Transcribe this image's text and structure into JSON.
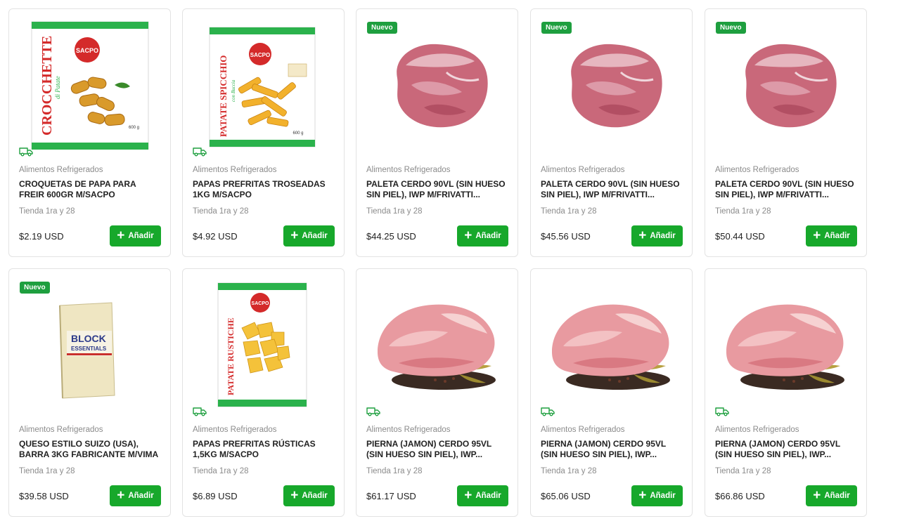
{
  "colors": {
    "accent": "#17a82b",
    "badge": "#1e9f3f",
    "muted": "#8b8b8b"
  },
  "products": [
    {
      "badge": "",
      "image": "croquettes-bag",
      "delivery": true,
      "brand_text": "SACPO",
      "package_name": "CROCCHETTE",
      "package_sub": "di Patate",
      "package_weight": "600 g",
      "category": "Alimentos Refrigerados",
      "title": "CROQUETAS DE PAPA PARA FREIR 600GR M/SACPO",
      "store": "Tienda 1ra y 28",
      "price": "$2.19 USD",
      "button": "Añadir"
    },
    {
      "badge": "",
      "image": "fries-bag",
      "delivery": true,
      "brand_text": "SACPO",
      "package_name": "PATATE SPICCHIO",
      "package_sub": "con Buccia",
      "package_weight": "600 g",
      "category": "Alimentos Refrigerados",
      "title": "PAPAS PREFRITAS TROSEADAS 1KG M/SACPO",
      "store": "Tienda 1ra y 28",
      "price": "$4.92 USD",
      "button": "Añadir"
    },
    {
      "badge": "Nuevo",
      "image": "pork-shoulder",
      "delivery": false,
      "category": "Alimentos Refrigerados",
      "title": "PALETA CERDO 90VL (SIN HUESO SIN PIEL), IWP M/FRIVATTI...",
      "store": "Tienda 1ra y 28",
      "price": "$44.25 USD",
      "button": "Añadir"
    },
    {
      "badge": "Nuevo",
      "image": "pork-shoulder",
      "delivery": false,
      "category": "Alimentos Refrigerados",
      "title": "PALETA CERDO 90VL (SIN HUESO SIN PIEL), IWP M/FRIVATTI...",
      "store": "Tienda 1ra y 28",
      "price": "$45.56 USD",
      "button": "Añadir"
    },
    {
      "badge": "Nuevo",
      "image": "pork-shoulder",
      "delivery": false,
      "category": "Alimentos Refrigerados",
      "title": "PALETA CERDO 90VL (SIN HUESO SIN PIEL), IWP M/FRIVATTI...",
      "store": "Tienda 1ra y 28",
      "price": "$50.44 USD",
      "button": "Añadir"
    },
    {
      "badge": "Nuevo",
      "image": "cheese-block",
      "delivery": false,
      "label_line1": "BLOCK",
      "label_line2": "ESSENTIALS",
      "category": "Alimentos Refrigerados",
      "title": "QUESO ESTILO SUIZO (USA), BARRA 3KG FABRICANTE M/VIMA",
      "store": "Tienda 1ra y 28",
      "price": "$39.58 USD",
      "button": "Añadir"
    },
    {
      "badge": "",
      "image": "rustic-bag",
      "delivery": true,
      "brand_text": "SACPO",
      "package_name": "PATATE RUSTICHE",
      "category": "Alimentos Refrigerados",
      "title": "PAPAS PREFRITAS RÚSTICAS 1,5KG M/SACPO",
      "store": "Tienda 1ra y 28",
      "price": "$6.89 USD",
      "button": "Añadir"
    },
    {
      "badge": "",
      "image": "pork-leg",
      "delivery": true,
      "category": "Alimentos Refrigerados",
      "title": "PIERNA (JAMON) CERDO 95VL (SIN HUESO SIN PIEL), IWP...",
      "store": "Tienda 1ra y 28",
      "price": "$61.17 USD",
      "button": "Añadir"
    },
    {
      "badge": "",
      "image": "pork-leg",
      "delivery": true,
      "category": "Alimentos Refrigerados",
      "title": "PIERNA (JAMON) CERDO 95VL (SIN HUESO SIN PIEL), IWP...",
      "store": "Tienda 1ra y 28",
      "price": "$65.06 USD",
      "button": "Añadir"
    },
    {
      "badge": "",
      "image": "pork-leg",
      "delivery": true,
      "category": "Alimentos Refrigerados",
      "title": "PIERNA (JAMON) CERDO 95VL (SIN HUESO SIN PIEL), IWP...",
      "store": "Tienda 1ra y 28",
      "price": "$66.86 USD",
      "button": "Añadir"
    }
  ]
}
